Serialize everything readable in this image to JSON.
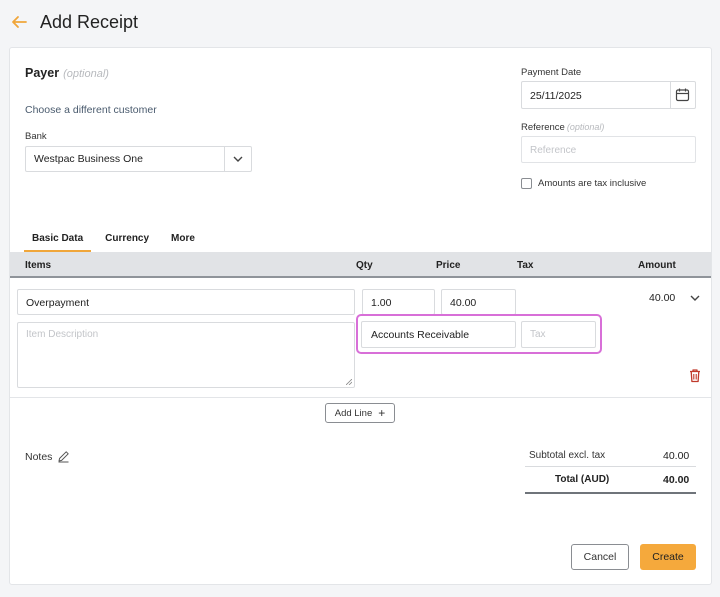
{
  "header": {
    "title": "Add Receipt"
  },
  "payer": {
    "title": "Payer",
    "optional": "(optional)",
    "choose_link": "Choose a different customer",
    "bank_label": "Bank",
    "bank_value": "Westpac Business One"
  },
  "payment": {
    "date_label": "Payment Date",
    "date_value": "25/11/2025",
    "reference_label": "Reference",
    "reference_optional": "(optional)",
    "reference_placeholder": "Reference",
    "tax_inclusive_label": "Amounts are tax inclusive",
    "tax_inclusive_checked": false
  },
  "tabs": [
    {
      "label": "Basic Data",
      "active": true
    },
    {
      "label": "Currency",
      "active": false
    },
    {
      "label": "More",
      "active": false
    }
  ],
  "table": {
    "columns": {
      "items": "Items",
      "qty": "Qty",
      "price": "Price",
      "tax": "Tax",
      "amount": "Amount"
    },
    "row": {
      "item": "Overpayment",
      "qty": "1.00",
      "price": "40.00",
      "amount": "40.00",
      "description_placeholder": "Item Description",
      "account": "Accounts Receivable",
      "tax_placeholder": "Tax"
    }
  },
  "add_line_label": "Add Line",
  "notes_label": "Notes",
  "totals": {
    "subtotal_label": "Subtotal excl. tax",
    "subtotal_value": "40.00",
    "total_label": "Total (AUD)",
    "total_value": "40.00"
  },
  "actions": {
    "cancel": "Cancel",
    "create": "Create"
  },
  "colors": {
    "accent": "#f5a93c",
    "highlight": "#d86fd8",
    "delete": "#c0392b"
  }
}
